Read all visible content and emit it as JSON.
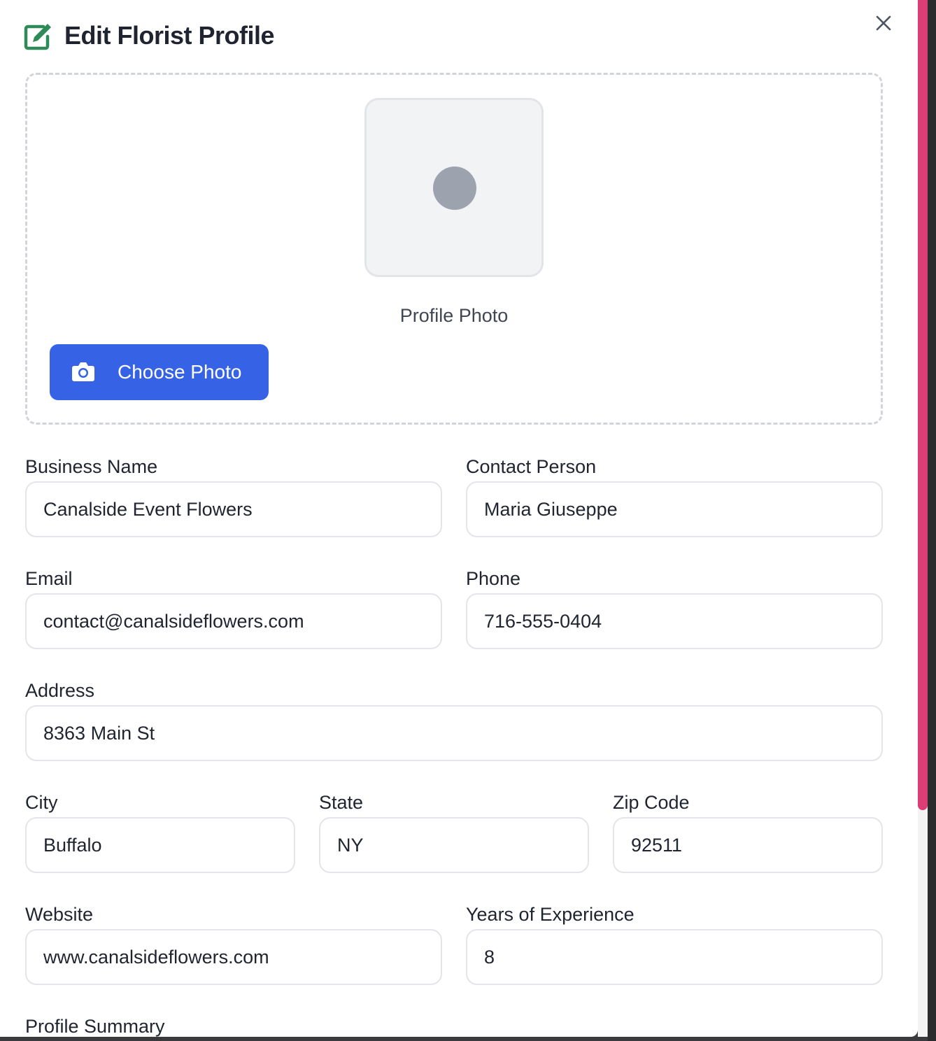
{
  "modal": {
    "title": "Edit Florist Profile",
    "accent_color": "#2e8b57",
    "header_icon": "edit-icon",
    "close_icon": "close-icon"
  },
  "photo": {
    "caption": "Profile Photo",
    "button_label": "Choose Photo",
    "button_icon": "camera-icon",
    "button_color": "#3663e6"
  },
  "form": {
    "business_name": {
      "label": "Business Name",
      "value": "Canalside Event Flowers"
    },
    "contact_person": {
      "label": "Contact Person",
      "value": "Maria Giuseppe"
    },
    "email": {
      "label": "Email",
      "value": "contact@canalsideflowers.com"
    },
    "phone": {
      "label": "Phone",
      "value": "716-555-0404"
    },
    "address": {
      "label": "Address",
      "value": "8363 Main St"
    },
    "city": {
      "label": "City",
      "value": "Buffalo"
    },
    "state": {
      "label": "State",
      "value": "NY"
    },
    "zip": {
      "label": "Zip Code",
      "value": "92511"
    },
    "website": {
      "label": "Website",
      "value": "www.canalsideflowers.com"
    },
    "experience": {
      "label": "Years of Experience",
      "value": "8"
    },
    "summary": {
      "label": "Profile Summary"
    }
  },
  "scrollbar_color": "#dc3d74"
}
